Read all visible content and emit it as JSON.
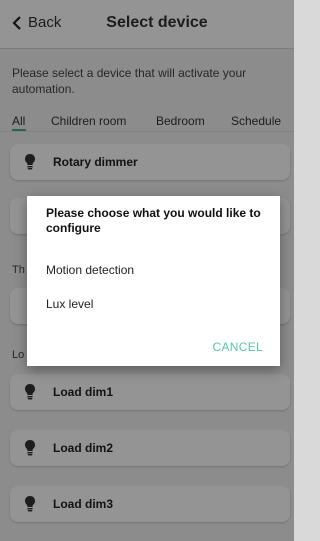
{
  "header": {
    "back_label": "Back",
    "title": "Select device"
  },
  "instruction": "Please select a device that will activate your automation.",
  "tabs": [
    {
      "label": "All",
      "active": true
    },
    {
      "label": "Children room",
      "active": false
    },
    {
      "label": "Bedroom",
      "active": false
    },
    {
      "label": "Schedule",
      "active": false
    }
  ],
  "devices_top": [
    {
      "label": "Rotary dimmer",
      "icon": "bulb-icon"
    },
    {
      "label": "",
      "icon": "bulb-icon"
    }
  ],
  "sections": [
    {
      "label": "Th",
      "partial": true
    },
    {
      "label": "Lo",
      "partial": true
    }
  ],
  "devices_bottom": [
    {
      "label": "Load dim1",
      "icon": "bulb-icon"
    },
    {
      "label": "Load dim2",
      "icon": "bulb-icon"
    },
    {
      "label": "Load dim3",
      "icon": "bulb-icon"
    }
  ],
  "dialog": {
    "title": "Please choose what you would like to configure",
    "options": [
      "Motion detection",
      "Lux level"
    ],
    "cancel_label": "CANCEL"
  },
  "colors": {
    "accent": "#5ec2a3",
    "tab_underline": "#4fae8a"
  }
}
